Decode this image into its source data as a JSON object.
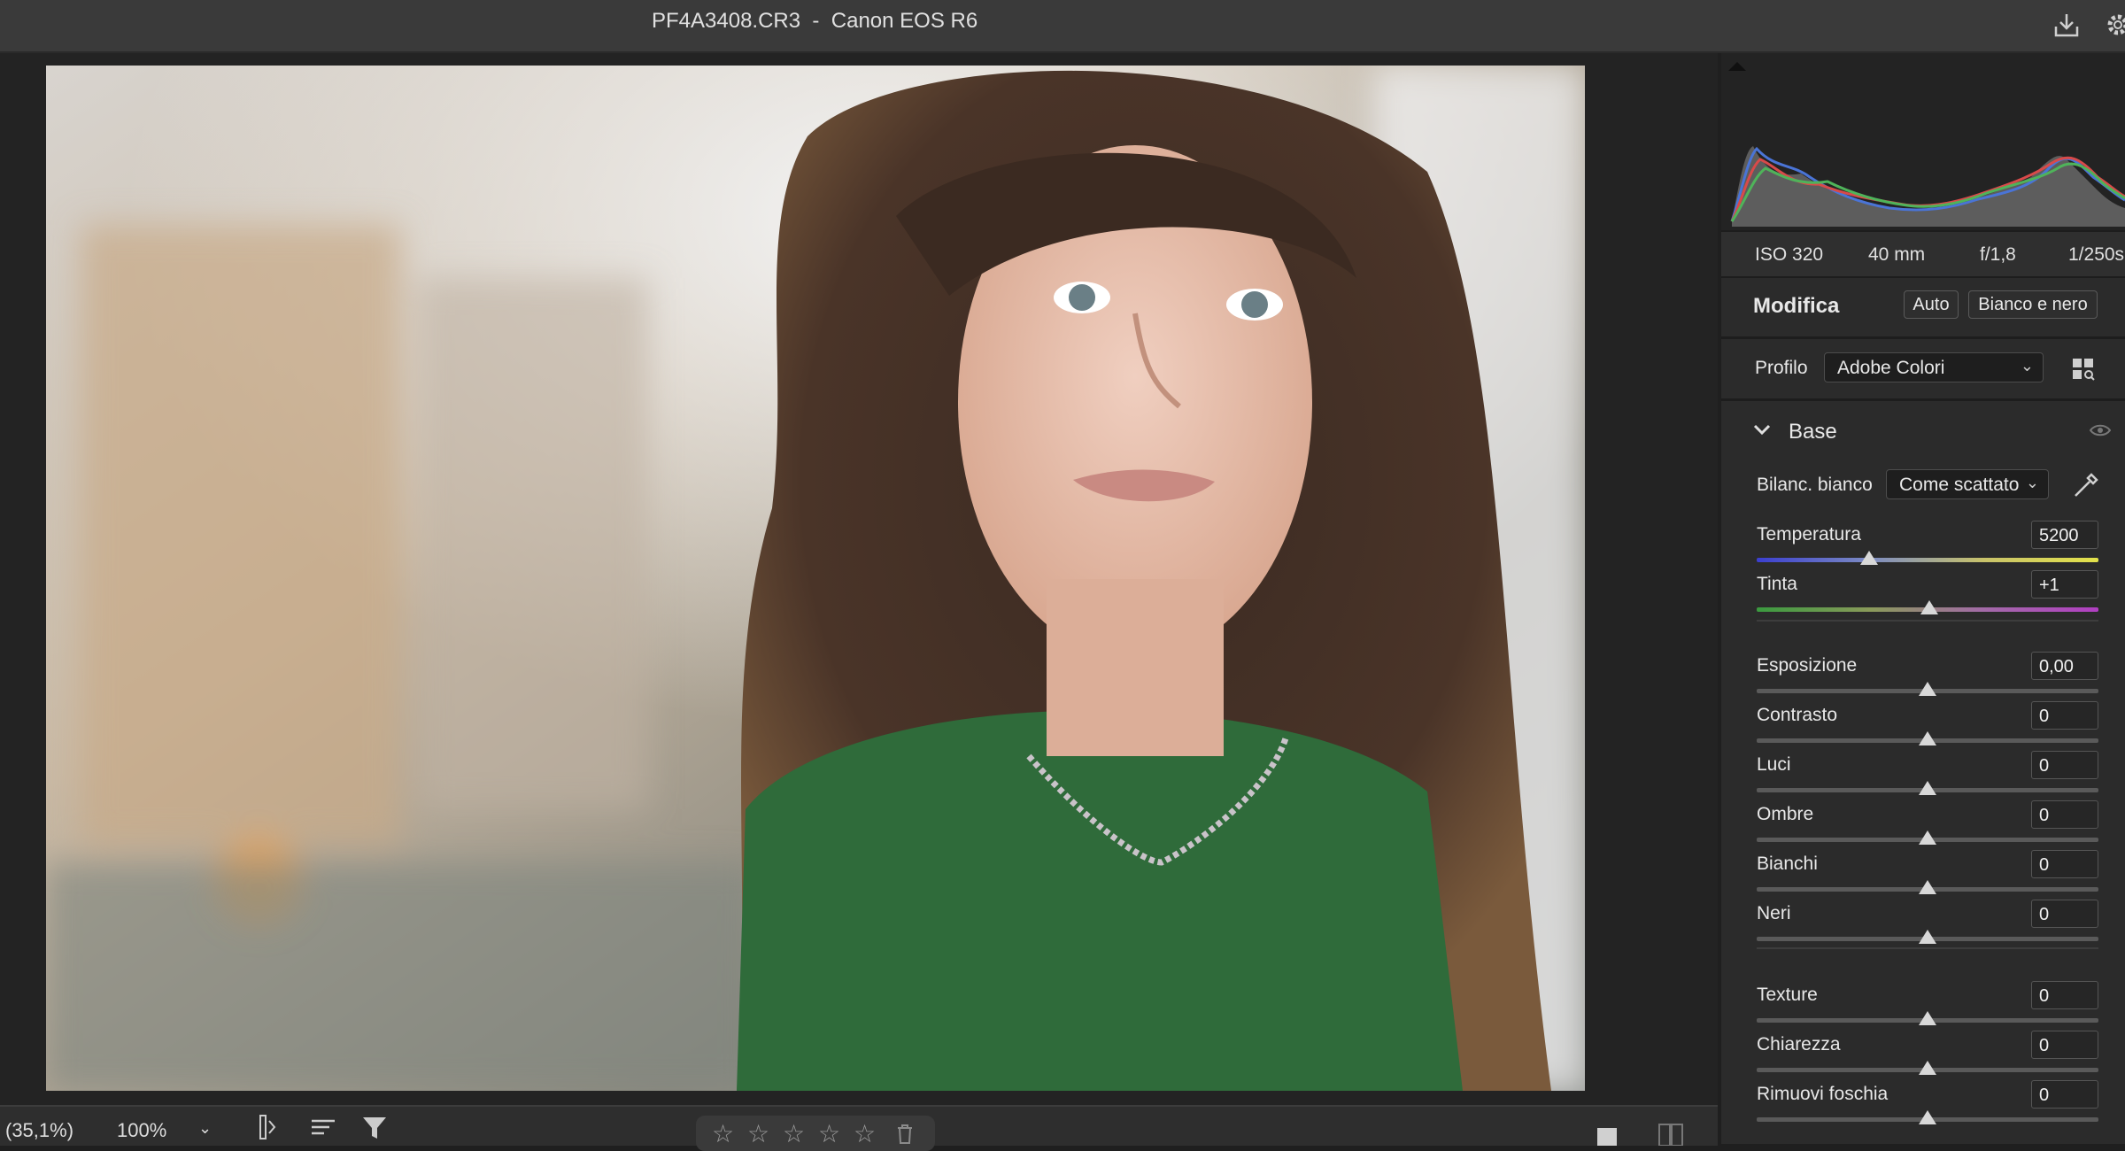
{
  "window": {
    "title": "PF4A3408.CR3  -  Canon EOS R6"
  },
  "icons": {
    "save": "download-icon",
    "settings": "gear-icon"
  },
  "bottom": {
    "fit_zoom": "(35,1%)",
    "zoom": "100%",
    "rating_stars": 5
  },
  "exif": {
    "iso": "ISO 320",
    "focal": "40 mm",
    "aperture": "f/1,8",
    "shutter": "1/250s"
  },
  "edit": {
    "title": "Modifica",
    "auto": "Auto",
    "bw": "Bianco e nero"
  },
  "profile": {
    "label": "Profilo",
    "value": "Adobe Colori"
  },
  "base": {
    "title": "Base"
  },
  "wb": {
    "label": "Bilanc. bianco",
    "value": "Come scattato"
  },
  "sliders": [
    {
      "label": "Temperatura",
      "value": "5200",
      "pos": 0.33
    },
    {
      "label": "Tinta",
      "value": "+1",
      "pos": 0.505
    },
    {
      "label": "Esposizione",
      "value": "0,00",
      "pos": 0.5
    },
    {
      "label": "Contrasto",
      "value": "0",
      "pos": 0.5
    },
    {
      "label": "Luci",
      "value": "0",
      "pos": 0.5
    },
    {
      "label": "Ombre",
      "value": "0",
      "pos": 0.5
    },
    {
      "label": "Bianchi",
      "value": "0",
      "pos": 0.5
    },
    {
      "label": "Neri",
      "value": "0",
      "pos": 0.5
    },
    {
      "label": "Texture",
      "value": "0",
      "pos": 0.5
    },
    {
      "label": "Chiarezza",
      "value": "0",
      "pos": 0.5
    },
    {
      "label": "Rimuovi foschia",
      "value": "0",
      "pos": 0.5
    }
  ]
}
